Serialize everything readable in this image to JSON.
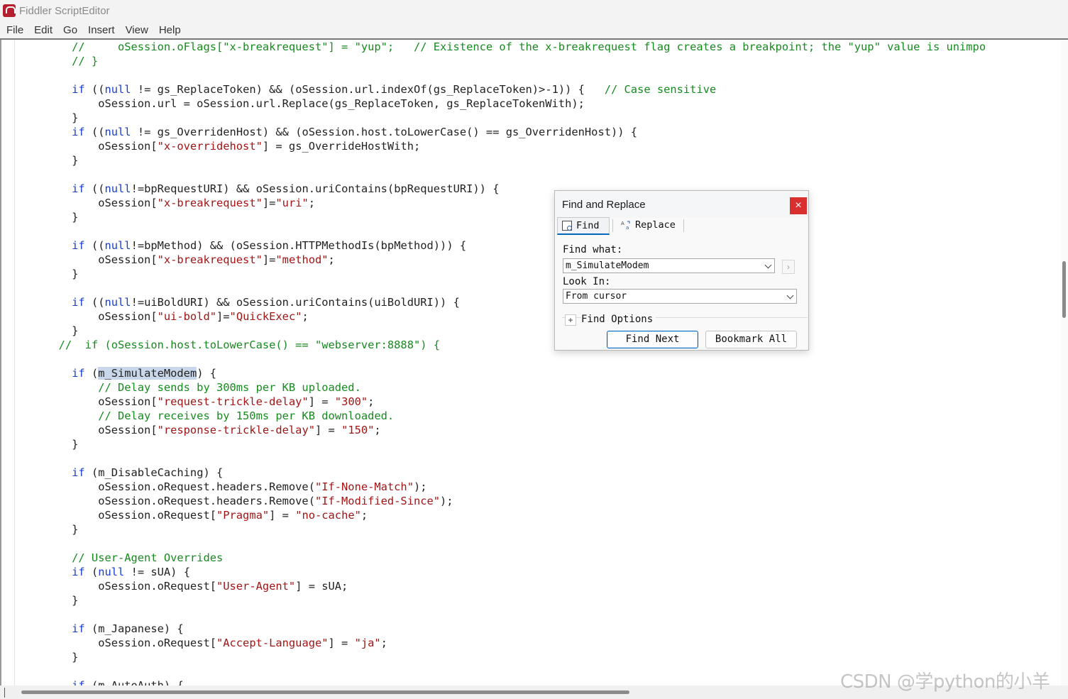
{
  "window": {
    "title": "Fiddler ScriptEditor"
  },
  "menu": [
    "File",
    "Edit",
    "Go",
    "Insert",
    "View",
    "Help"
  ],
  "code_lines": [
    [
      [
        "cm",
        "        //     oSession.oFlags[\"x-breakrequest\"] = \"yup\";   // Existence of the x-breakrequest flag creates a breakpoint; the \"yup\" value is unimpo"
      ]
    ],
    [
      [
        "cm",
        "        // }"
      ]
    ],
    [
      [
        "t",
        ""
      ]
    ],
    [
      [
        "kw",
        "        if"
      ],
      [
        "t",
        " (("
      ],
      [
        "kw",
        "null"
      ],
      [
        "t",
        " != gs_ReplaceToken) && (oSession.url.indexOf(gs_ReplaceToken)>-1)) {   "
      ],
      [
        "cm",
        "// Case sensitive"
      ]
    ],
    [
      [
        "t",
        "            oSession.url = oSession.url.Replace(gs_ReplaceToken, gs_ReplaceTokenWith);"
      ]
    ],
    [
      [
        "t",
        "        }"
      ]
    ],
    [
      [
        "kw",
        "        if"
      ],
      [
        "t",
        " (("
      ],
      [
        "kw",
        "null"
      ],
      [
        "t",
        " != gs_OverridenHost) && (oSession.host.toLowerCase() == gs_OverridenHost)) {"
      ]
    ],
    [
      [
        "t",
        "            oSession["
      ],
      [
        "str",
        "\"x-overridehost\""
      ],
      [
        "t",
        "] = gs_OverrideHostWith;"
      ]
    ],
    [
      [
        "t",
        "        }"
      ]
    ],
    [
      [
        "t",
        ""
      ]
    ],
    [
      [
        "kw",
        "        if"
      ],
      [
        "t",
        " (("
      ],
      [
        "kw",
        "null"
      ],
      [
        "t",
        "!=bpRequestURI) && oSession.uriContains(bpRequestURI)) {"
      ]
    ],
    [
      [
        "t",
        "            oSession["
      ],
      [
        "str",
        "\"x-breakrequest\""
      ],
      [
        "t",
        "]="
      ],
      [
        "str",
        "\"uri\""
      ],
      [
        "t",
        ";"
      ]
    ],
    [
      [
        "t",
        "        }"
      ]
    ],
    [
      [
        "t",
        ""
      ]
    ],
    [
      [
        "kw",
        "        if"
      ],
      [
        "t",
        " (("
      ],
      [
        "kw",
        "null"
      ],
      [
        "t",
        "!=bpMethod) && (oSession.HTTPMethodIs(bpMethod))) {"
      ]
    ],
    [
      [
        "t",
        "            oSession["
      ],
      [
        "str",
        "\"x-breakrequest\""
      ],
      [
        "t",
        "]="
      ],
      [
        "str",
        "\"method\""
      ],
      [
        "t",
        ";"
      ]
    ],
    [
      [
        "t",
        "        }"
      ]
    ],
    [
      [
        "t",
        ""
      ]
    ],
    [
      [
        "kw",
        "        if"
      ],
      [
        "t",
        " (("
      ],
      [
        "kw",
        "null"
      ],
      [
        "t",
        "!=uiBoldURI) && oSession.uriContains(uiBoldURI)) {"
      ]
    ],
    [
      [
        "t",
        "            oSession["
      ],
      [
        "str",
        "\"ui-bold\""
      ],
      [
        "t",
        "]="
      ],
      [
        "str",
        "\"QuickExec\""
      ],
      [
        "t",
        ";"
      ]
    ],
    [
      [
        "t",
        "        }"
      ]
    ],
    [
      [
        "cm",
        "      //  if (oSession.host.toLowerCase() == \"webserver:8888\") {                                                }"
      ]
    ],
    [
      [
        "t",
        ""
      ]
    ],
    [
      [
        "kw",
        "        if"
      ],
      [
        "t",
        " ("
      ],
      [
        "hl",
        "m_SimulateModem"
      ],
      [
        "t",
        ") {"
      ]
    ],
    [
      [
        "cm",
        "            // Delay sends by 300ms per KB uploaded."
      ]
    ],
    [
      [
        "t",
        "            oSession["
      ],
      [
        "str",
        "\"request-trickle-delay\""
      ],
      [
        "t",
        "] = "
      ],
      [
        "str",
        "\"300\""
      ],
      [
        "t",
        ";"
      ]
    ],
    [
      [
        "cm",
        "            // Delay receives by 150ms per KB downloaded."
      ]
    ],
    [
      [
        "t",
        "            oSession["
      ],
      [
        "str",
        "\"response-trickle-delay\""
      ],
      [
        "t",
        "] = "
      ],
      [
        "str",
        "\"150\""
      ],
      [
        "t",
        ";"
      ]
    ],
    [
      [
        "t",
        "        }"
      ]
    ],
    [
      [
        "t",
        ""
      ]
    ],
    [
      [
        "kw",
        "        if"
      ],
      [
        "t",
        " (m_DisableCaching) {"
      ]
    ],
    [
      [
        "t",
        "            oSession.oRequest.headers.Remove("
      ],
      [
        "str",
        "\"If-None-Match\""
      ],
      [
        "t",
        ");"
      ]
    ],
    [
      [
        "t",
        "            oSession.oRequest.headers.Remove("
      ],
      [
        "str",
        "\"If-Modified-Since\""
      ],
      [
        "t",
        ");"
      ]
    ],
    [
      [
        "t",
        "            oSession.oRequest["
      ],
      [
        "str",
        "\"Pragma\""
      ],
      [
        "t",
        "] = "
      ],
      [
        "str",
        "\"no-cache\""
      ],
      [
        "t",
        ";"
      ]
    ],
    [
      [
        "t",
        "        }"
      ]
    ],
    [
      [
        "t",
        ""
      ]
    ],
    [
      [
        "cm",
        "        // User-Agent Overrides"
      ]
    ],
    [
      [
        "kw",
        "        if"
      ],
      [
        "t",
        " ("
      ],
      [
        "kw",
        "null"
      ],
      [
        "t",
        " != sUA) {"
      ]
    ],
    [
      [
        "t",
        "            oSession.oRequest["
      ],
      [
        "str",
        "\"User-Agent\""
      ],
      [
        "t",
        "] = sUA;"
      ]
    ],
    [
      [
        "t",
        "        }"
      ]
    ],
    [
      [
        "t",
        ""
      ]
    ],
    [
      [
        "kw",
        "        if"
      ],
      [
        "t",
        " (m_Japanese) {"
      ]
    ],
    [
      [
        "t",
        "            oSession.oRequest["
      ],
      [
        "str",
        "\"Accept-Language\""
      ],
      [
        "t",
        "] = "
      ],
      [
        "str",
        "\"ja\""
      ],
      [
        "t",
        ";"
      ]
    ],
    [
      [
        "t",
        "        }"
      ]
    ],
    [
      [
        "t",
        ""
      ]
    ],
    [
      [
        "kw",
        "        if"
      ],
      [
        "t",
        " (m_AutoAuth) {"
      ]
    ]
  ],
  "dialog": {
    "title": "Find and Replace",
    "close": "×",
    "tab_find": "Find",
    "tab_replace": "Replace",
    "find_what_label": "Find what:",
    "find_what_value": "m_SimulateModem",
    "go_glyph": "›",
    "look_in_label": "Look In:",
    "look_in_value": "From cursor",
    "find_options_label": "Find Options",
    "find_options_glyph": "+",
    "find_next": "Find Next",
    "bookmark_all": "Bookmark All"
  },
  "watermark": "CSDN @学python的小羊",
  "colors": {
    "keyword": "#1a3ccf",
    "string": "#a31515",
    "comment": "#178a1f",
    "highlight": "#c9d7ea",
    "close_button": "#d92f2f"
  }
}
